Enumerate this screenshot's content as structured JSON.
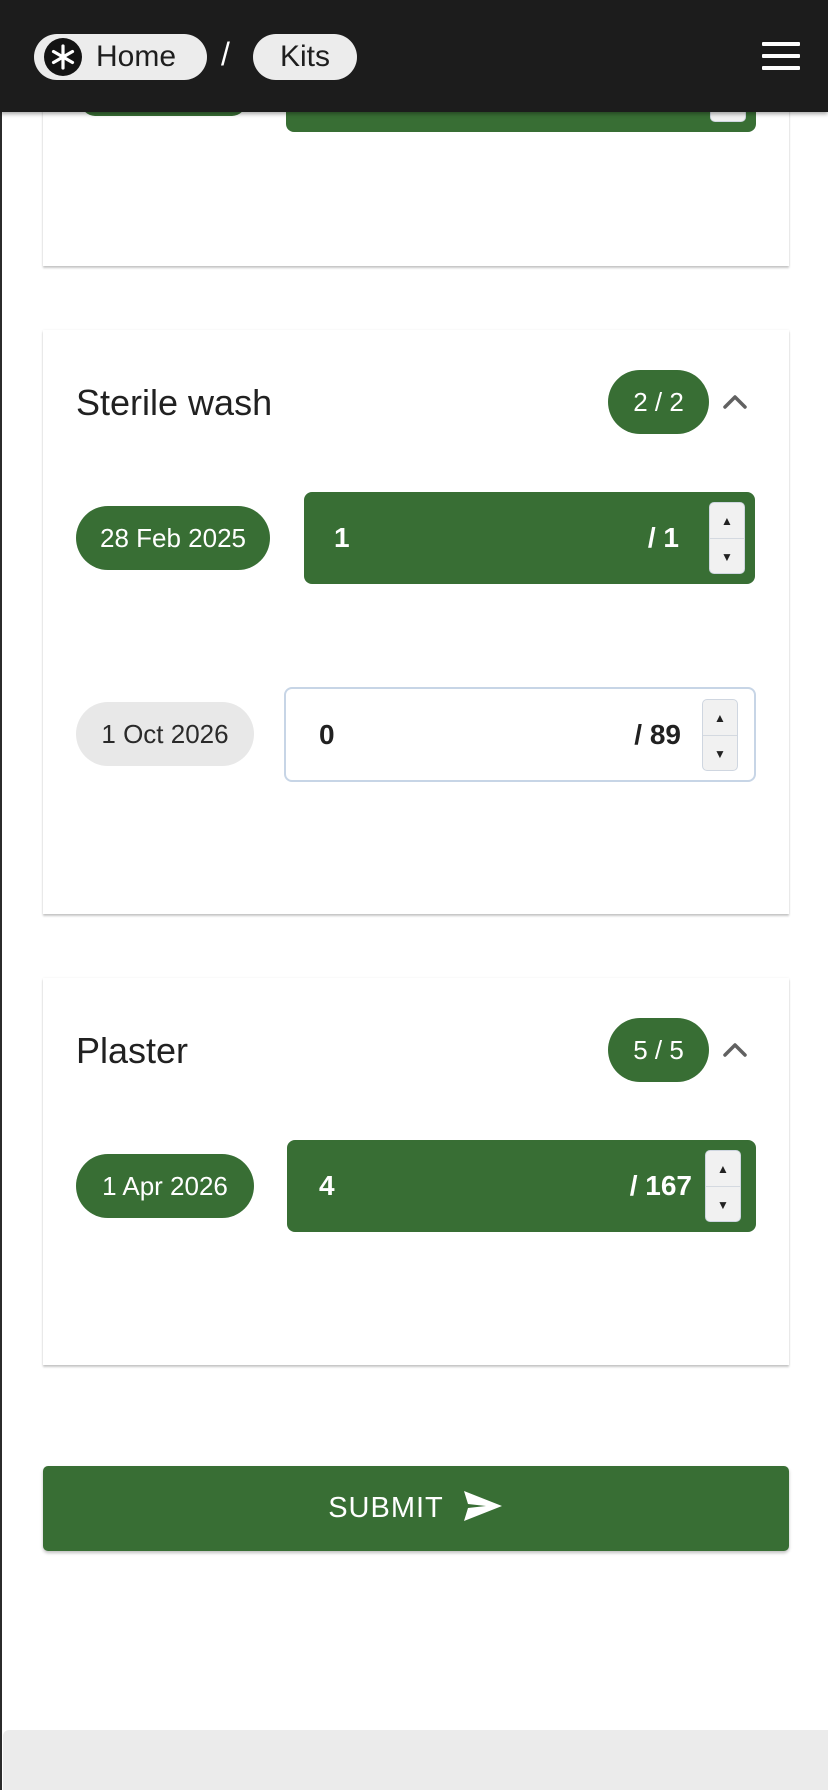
{
  "header": {
    "breadcrumbs": [
      {
        "label": "Home",
        "icon": "star-of-life-icon"
      },
      {
        "label": "Kits"
      }
    ],
    "separator": "/",
    "menu_icon": "hamburger-menu-icon"
  },
  "colors": {
    "accent_green": "#386e34",
    "header_bg": "#1c1c1c",
    "chip_grey": "#e8e8e8"
  },
  "sections": [
    {
      "title": "Sterile wash",
      "count": "2 / 2",
      "expanded": true,
      "items": [
        {
          "date": "28 Feb 2025",
          "quantity": "1",
          "total": "/ 1",
          "style": "green"
        },
        {
          "date": "1 Oct 2026",
          "quantity": "0",
          "total": "/ 89",
          "style": "grey"
        }
      ]
    },
    {
      "title": "Plaster",
      "count": "5 / 5",
      "expanded": true,
      "items": [
        {
          "date": "1 Apr 2026",
          "quantity": "4",
          "total": "/ 167",
          "style": "green"
        }
      ]
    }
  ],
  "stepper": {
    "up": "▲",
    "down": "▼"
  },
  "submit": {
    "label": "SUBMIT",
    "icon": "send-icon"
  }
}
